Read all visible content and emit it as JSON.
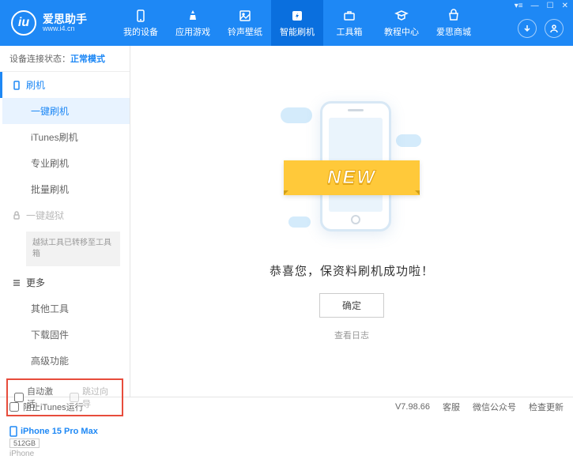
{
  "app": {
    "title": "爱思助手",
    "subtitle": "www.i4.cn"
  },
  "nav": {
    "items": [
      {
        "label": "我的设备"
      },
      {
        "label": "应用游戏"
      },
      {
        "label": "铃声壁纸"
      },
      {
        "label": "智能刷机"
      },
      {
        "label": "工具箱"
      },
      {
        "label": "教程中心"
      },
      {
        "label": "爱思商城"
      }
    ]
  },
  "sidebar": {
    "status_label": "设备连接状态：",
    "status_value": "正常模式",
    "groups": {
      "flash": {
        "title": "刷机",
        "items": [
          "一键刷机",
          "iTunes刷机",
          "专业刷机",
          "批量刷机"
        ]
      },
      "jailbreak": {
        "title": "一键越狱",
        "notice": "越狱工具已转移至工具箱"
      },
      "more": {
        "title": "更多",
        "items": [
          "其他工具",
          "下载固件",
          "高级功能"
        ]
      }
    },
    "options": {
      "auto_activate": "自动激活",
      "skip_guide": "跳过向导"
    },
    "device": {
      "name": "iPhone 15 Pro Max",
      "storage": "512GB",
      "type": "iPhone"
    }
  },
  "main": {
    "banner_text": "NEW",
    "success": "恭喜您，保资料刷机成功啦！",
    "confirm": "确定",
    "view_log": "查看日志"
  },
  "footer": {
    "block_itunes": "阻止iTunes运行",
    "version": "V7.98.66",
    "links": [
      "客服",
      "微信公众号",
      "检查更新"
    ]
  }
}
